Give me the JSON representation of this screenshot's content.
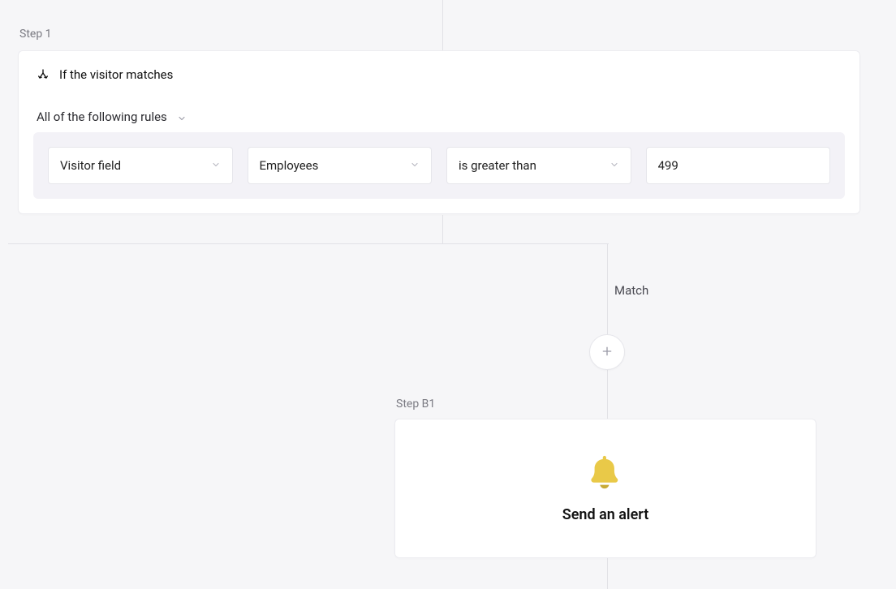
{
  "step1": {
    "label": "Step 1",
    "header": "If the visitor matches",
    "rules_mode": "All of the following rules",
    "rule": {
      "type": "Visitor field",
      "field": "Employees",
      "operator": "is greater than",
      "value": "499"
    }
  },
  "branch": {
    "match_label": "Match"
  },
  "stepB1": {
    "label": "Step B1",
    "title": "Send an alert"
  }
}
